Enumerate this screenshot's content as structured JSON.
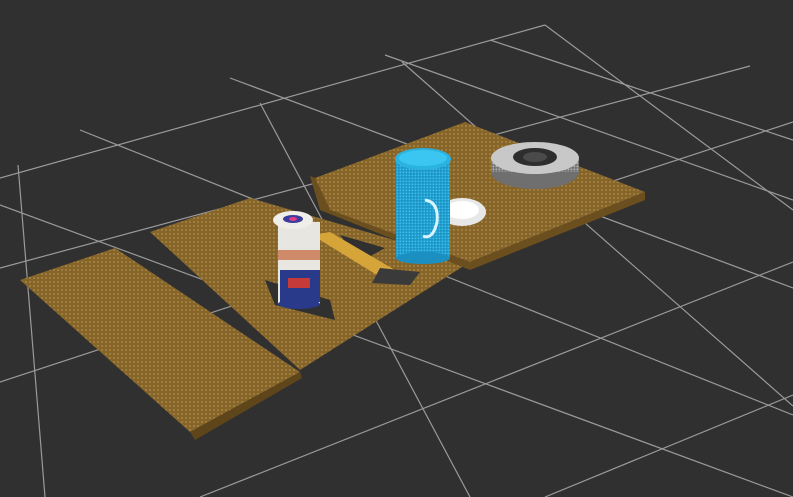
{
  "viewport": {
    "background": "#303030",
    "grid_color": "#a0a0a0",
    "table_color": "#8c6a2e",
    "table_edge_color": "#6b4f1e",
    "shadow_color": "#303030"
  },
  "objects": {
    "cyan_can": {
      "color": "#2bb3e0"
    },
    "bowl": {
      "color": "#f2f2f2"
    },
    "roll": {
      "color": "#8a8a8a"
    },
    "tall_can": {
      "color": "#2a3a8a"
    },
    "tool": {
      "color": "#d6a53a"
    }
  }
}
